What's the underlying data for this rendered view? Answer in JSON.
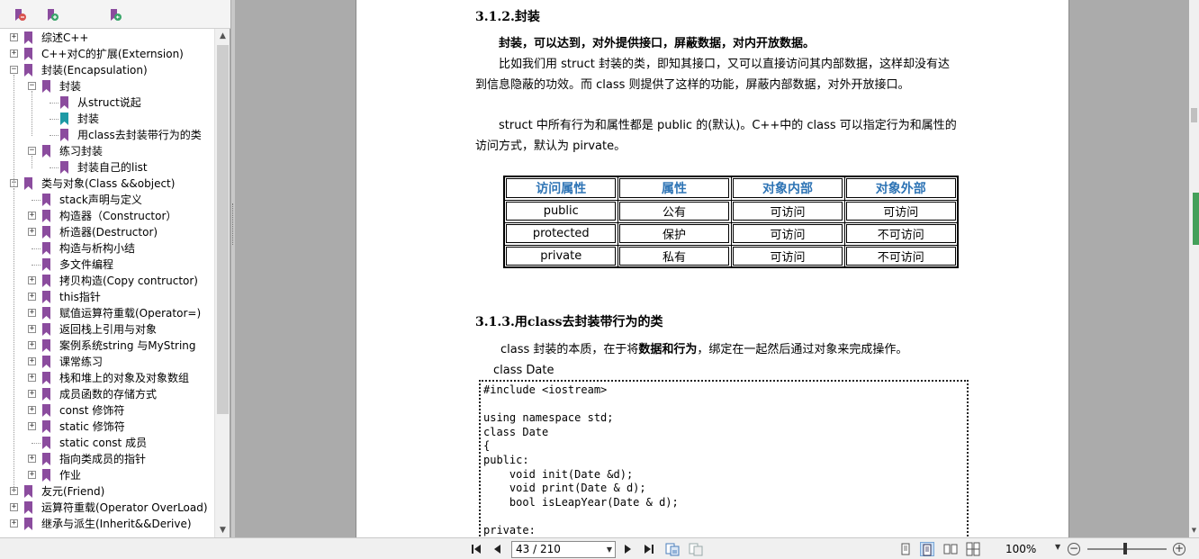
{
  "bookmarks_panel": {
    "toolbar_icons": [
      "bookmark-delete-icon",
      "bookmark-add-icon",
      "bookmark-goto-icon"
    ],
    "items": [
      {
        "label": "综述C++",
        "level": 0,
        "expander": "+",
        "selected": false
      },
      {
        "label": "C++对C的扩展(Externsion)",
        "level": 0,
        "expander": "+",
        "selected": false
      },
      {
        "label": "封装(Encapsulation)",
        "level": 0,
        "expander": "−",
        "selected": false
      },
      {
        "label": "封装",
        "level": 1,
        "expander": "−",
        "selected": false
      },
      {
        "label": "从struct说起",
        "level": 2,
        "expander": "",
        "selected": false
      },
      {
        "label": "封装",
        "level": 2,
        "expander": "",
        "selected": true
      },
      {
        "label": "用class去封装带行为的类",
        "level": 2,
        "expander": "",
        "selected": false
      },
      {
        "label": "练习封装",
        "level": 1,
        "expander": "−",
        "selected": false
      },
      {
        "label": "封装自己的list",
        "level": 2,
        "expander": "",
        "selected": false
      },
      {
        "label": "类与对象(Class &&object)",
        "level": 0,
        "expander": "−",
        "selected": false
      },
      {
        "label": "stack声明与定义",
        "level": 1,
        "expander": "",
        "selected": false
      },
      {
        "label": "构造器（Constructor）",
        "level": 1,
        "expander": "+",
        "selected": false
      },
      {
        "label": "析造器(Destructor)",
        "level": 1,
        "expander": "+",
        "selected": false
      },
      {
        "label": "构造与析构小结",
        "level": 1,
        "expander": "",
        "selected": false
      },
      {
        "label": "多文件编程",
        "level": 1,
        "expander": "",
        "selected": false
      },
      {
        "label": "拷贝构造(Copy contructor)",
        "level": 1,
        "expander": "+",
        "selected": false
      },
      {
        "label": "this指针",
        "level": 1,
        "expander": "+",
        "selected": false
      },
      {
        "label": "赋值运算符重载(Operator=)",
        "level": 1,
        "expander": "+",
        "selected": false
      },
      {
        "label": "返回栈上引用与对象",
        "level": 1,
        "expander": "+",
        "selected": false
      },
      {
        "label": "案例系统string 与MyString",
        "level": 1,
        "expander": "+",
        "selected": false
      },
      {
        "label": "课常练习",
        "level": 1,
        "expander": "+",
        "selected": false
      },
      {
        "label": "栈和堆上的对象及对象数组",
        "level": 1,
        "expander": "+",
        "selected": false
      },
      {
        "label": "成员函数的存储方式",
        "level": 1,
        "expander": "+",
        "selected": false
      },
      {
        "label": "const 修饰符",
        "level": 1,
        "expander": "+",
        "selected": false
      },
      {
        "label": "static 修饰符",
        "level": 1,
        "expander": "+",
        "selected": false
      },
      {
        "label": "static const 成员",
        "level": 1,
        "expander": "",
        "selected": false
      },
      {
        "label": "指向类成员的指针",
        "level": 1,
        "expander": "+",
        "selected": false
      },
      {
        "label": "作业",
        "level": 1,
        "expander": "+",
        "selected": false
      },
      {
        "label": "友元(Friend)",
        "level": 0,
        "expander": "+",
        "selected": false
      },
      {
        "label": "运算符重载(Operator OverLoad)",
        "level": 0,
        "expander": "+",
        "selected": false
      },
      {
        "label": "继承与派生(Inherit&&Derive)",
        "level": 0,
        "expander": "+",
        "selected": false
      }
    ]
  },
  "document": {
    "heading_312": "3.1.2.封装",
    "p1_bold": "封装，可以达到，对外提供接口，屏蔽数据，对内开放数据。",
    "p2_line1": "比如我们用 struct  封装的类，即知其接口，又可以直接访问其内部数据，这样却没有达",
    "p2_line2": "到信息隐蔽的功效。而 class 则提供了这样的功能，屏蔽内部数据，对外开放接口。",
    "p3_line1": "struct  中所有行为和属性都是 public 的(默认)。C++中的 class 可以指定行为和属性的",
    "p3_line2": "访问方式，默认为 pirvate。",
    "table": {
      "headers": [
        "访问属性",
        "属性",
        "对象内部",
        "对象外部"
      ],
      "rows": [
        [
          "public",
          "公有",
          "可访问",
          "可访问"
        ],
        [
          "protected",
          "保护",
          "可访问",
          "不可访问"
        ],
        [
          "private",
          "私有",
          "可访问",
          "不可访问"
        ]
      ]
    },
    "heading_313": "3.1.3.用class去封装带行为的类",
    "p4_pre": "class  封装的本质，在于将",
    "p4_bold": "数据和行为",
    "p4_post": "，绑定在一起然后通过对象来完成操作。",
    "class_label": "class Date",
    "code_lines": [
      "#include <iostream>",
      "",
      "using namespace std;",
      "class Date",
      "{",
      "public:",
      "    void init(Date &d);",
      "    void print(Date & d);",
      "    bool isLeapYear(Date & d);",
      "",
      "private:"
    ]
  },
  "status_bar": {
    "page_indicator": "43 / 210",
    "zoom": "100%",
    "zoom_level_percent": 100
  }
}
